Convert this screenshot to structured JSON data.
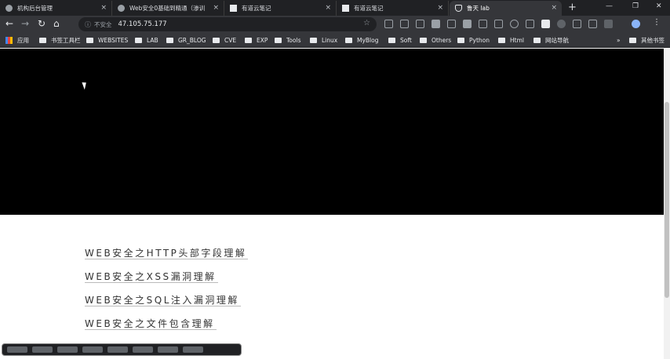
{
  "tabs": [
    {
      "title": "机构后台管理",
      "close": "×"
    },
    {
      "title": "Web安全0基础到精通（渗训",
      "close": "×"
    },
    {
      "title": "有道云笔记",
      "close": "×"
    },
    {
      "title": "有道云笔记",
      "close": "×"
    },
    {
      "title": "鲁天 lab",
      "close": "×"
    }
  ],
  "new_tab": "+",
  "window": {
    "minimize": "—",
    "maximize": "❐",
    "close": "✕"
  },
  "toolbar": {
    "back": "←",
    "forward": "→",
    "reload": "↻",
    "home": "⌂",
    "security_label": "不安全",
    "url": "47.105.75.177",
    "star": "☆"
  },
  "bookmarks": {
    "items": [
      "应用",
      "书签工具栏",
      "WEBSITES",
      "LAB",
      "GR_BLOG",
      "CVE",
      "EXP",
      "Tools",
      "Linux",
      "MyBlog",
      "Soft",
      "Others",
      "Python",
      "Html",
      "网站导航"
    ],
    "more": "»",
    "other": "其他书签"
  },
  "posts": [
    "WEB安全之HTTP头部字段理解",
    "WEB安全之XSS漏洞理解",
    "WEB安全之SQL注入漏洞理解",
    "WEB安全之文件包含理解"
  ]
}
